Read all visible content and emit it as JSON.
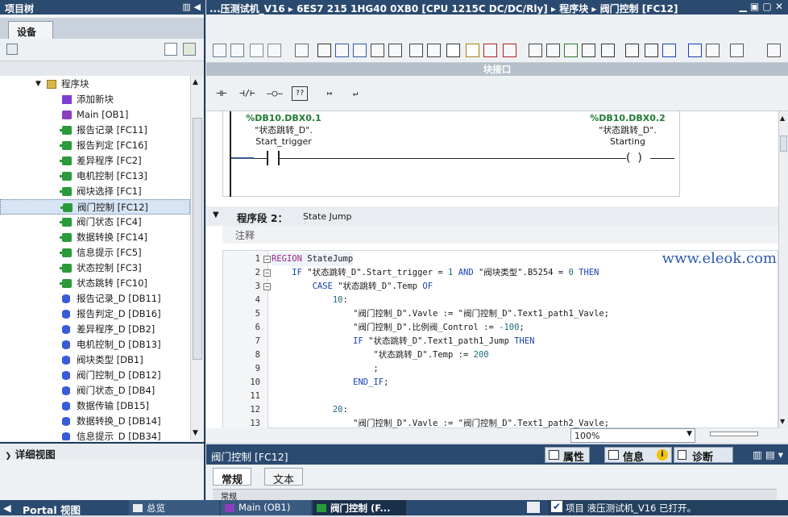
{
  "left_panel": {
    "title": "项目树",
    "tab": "设备",
    "detail_title": "详细视图"
  },
  "tree": {
    "folder": "程序块",
    "items": [
      {
        "label": "添加新块",
        "icon": "add-block-icon"
      },
      {
        "label": "Main [OB1]",
        "icon": "ob-block-icon"
      },
      {
        "label": "报告记录 [FC11]",
        "icon": "fc-block-icon"
      },
      {
        "label": "报告判定 [FC16]",
        "icon": "fc-block-icon"
      },
      {
        "label": "差异程序 [FC2]",
        "icon": "fc-block-icon"
      },
      {
        "label": "电机控制 [FC13]",
        "icon": "fc-block-icon"
      },
      {
        "label": "阀块选择 [FC1]",
        "icon": "fc-block-icon"
      },
      {
        "label": "阀门控制 [FC12]",
        "icon": "fc-block-icon",
        "selected": true
      },
      {
        "label": "阀门状态 [FC4]",
        "icon": "fc-block-icon"
      },
      {
        "label": "数据转换 [FC14]",
        "icon": "fc-block-icon"
      },
      {
        "label": "信息提示 [FC5]",
        "icon": "fc-block-icon"
      },
      {
        "label": "状态控制 [FC3]",
        "icon": "fc-block-icon"
      },
      {
        "label": "状态跳转 [FC10]",
        "icon": "fc-block-icon"
      },
      {
        "label": "报告记录_D [DB11]",
        "icon": "db-block-icon"
      },
      {
        "label": "报告判定_D [DB16]",
        "icon": "db-block-icon"
      },
      {
        "label": "差异程序_D [DB2]",
        "icon": "db-block-icon"
      },
      {
        "label": "电机控制_D [DB13]",
        "icon": "db-block-icon"
      },
      {
        "label": "阀块类型 [DB1]",
        "icon": "db-block-icon"
      },
      {
        "label": "阀门控制_D [DB12]",
        "icon": "db-block-icon"
      },
      {
        "label": "阀门状态_D [DB4]",
        "icon": "db-block-icon"
      },
      {
        "label": "数据传输 [DB15]",
        "icon": "db-block-icon"
      },
      {
        "label": "数据转换_D [DB14]",
        "icon": "db-block-icon"
      },
      {
        "label": "信息提示_D [DB34]",
        "icon": "db-block-icon"
      }
    ]
  },
  "header": {
    "breadcrumb_1": "...压测试机_V16",
    "breadcrumb_2": "6ES7 215 1HG40 0XB0 [CPU 1215C DC/DC/Rly]",
    "breadcrumb_3": "程序块",
    "breadcrumb_4": "阀门控制 [FC12]",
    "sep": "▸"
  },
  "interface_bar": "块接口",
  "ladder_buttons": [
    "⊣⊢",
    "⊣/⊢",
    "–○–",
    "??",
    "↦",
    "↵"
  ],
  "network1": {
    "left_addr": "%DB10.DBX0.1",
    "left_tag": "\"状态跳转_D\".",
    "left_member": "Start_trigger",
    "right_addr": "%DB10.DBX0.2",
    "right_tag": "\"状态跳转_D\".",
    "right_member": "Starting"
  },
  "segment2": {
    "title": "程序段 2：",
    "name": "State Jump",
    "comment": "注释"
  },
  "code_lines": [
    {
      "n": "1",
      "text": "REGION StateJump"
    },
    {
      "n": "2",
      "text": "    IF \"状态跳转_D\".Start_trigger = 1 AND \"阀块类型\".B5254 = 0 THEN"
    },
    {
      "n": "3",
      "text": "        CASE \"状态跳转_D\".Temp OF"
    },
    {
      "n": "4",
      "text": "            10:"
    },
    {
      "n": "5",
      "text": "                \"阀门控制_D\".Vavle := \"阀门控制_D\".Text1_path1_Vavle;"
    },
    {
      "n": "6",
      "text": "                \"阀门控制_D\".比例阀_Control := -100;"
    },
    {
      "n": "7",
      "text": "                IF \"状态跳转_D\".Text1_path1_Jump THEN"
    },
    {
      "n": "8",
      "text": "                    \"状态跳转_D\".Temp := 200"
    },
    {
      "n": "9",
      "text": "                    ;"
    },
    {
      "n": "10",
      "text": "                END_IF;"
    },
    {
      "n": "11",
      "text": ""
    },
    {
      "n": "12",
      "text": "            20:"
    },
    {
      "n": "13",
      "text": "                \"阀门控制_D\".Vavle := \"阀门控制_D\".Text1_path2_Vavle;"
    }
  ],
  "watermark": "www.eleok.com",
  "zoom": "100%",
  "inspector": {
    "title": "阀门控制 [FC12]",
    "tab_properties": "属性",
    "tab_info": "信息",
    "tab_diagnostics": "诊断",
    "sub_general": "常规",
    "sub_text": "文本",
    "sub_partial": "常规"
  },
  "statusbar": {
    "portal": "Portal 视图",
    "tab_overview": "总览",
    "tab_main": "Main (OB1)",
    "tab_valve": "阀门控制 (F...",
    "message": "项目 液压测试机_V16 已打开。"
  }
}
